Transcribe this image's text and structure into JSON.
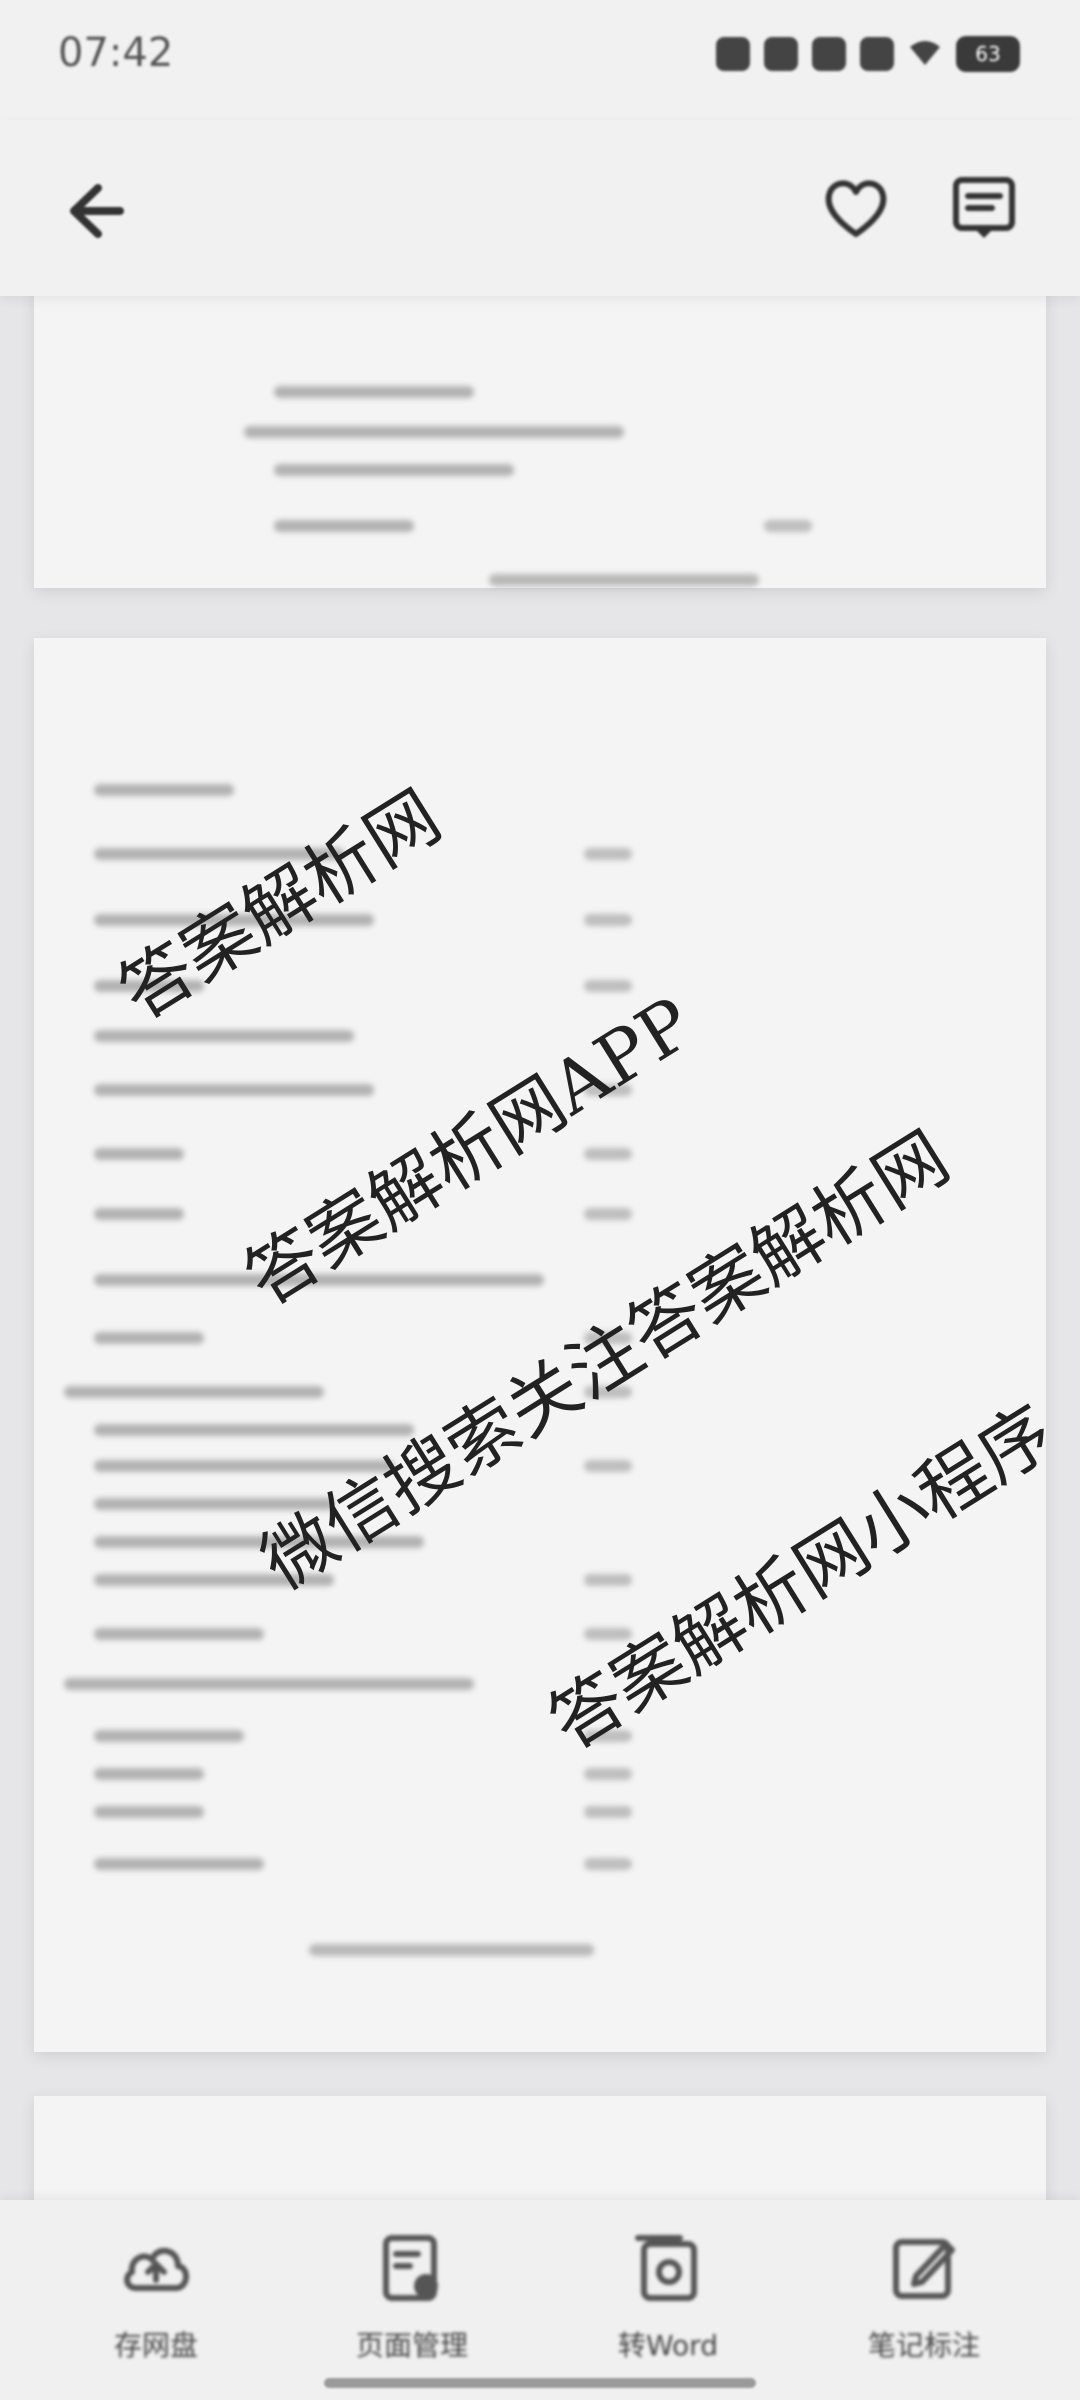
{
  "status_bar": {
    "time": "07:42",
    "battery": "63"
  },
  "toolbar": {
    "back_icon": "arrow-left-icon",
    "favorite_icon": "heart-icon",
    "note_icon": "note-icon"
  },
  "watermarks": [
    "答案解析网",
    "答案解析网APP",
    "微信搜索关注答案解析网",
    "答案解析网小程序"
  ],
  "bottom_nav": {
    "items": [
      {
        "label": "存网盘",
        "icon": "cloud-save-icon"
      },
      {
        "label": "页面管理",
        "icon": "page-manage-icon"
      },
      {
        "label": "转Word",
        "icon": "convert-word-icon"
      },
      {
        "label": "笔记标注",
        "icon": "edit-note-icon"
      }
    ]
  }
}
